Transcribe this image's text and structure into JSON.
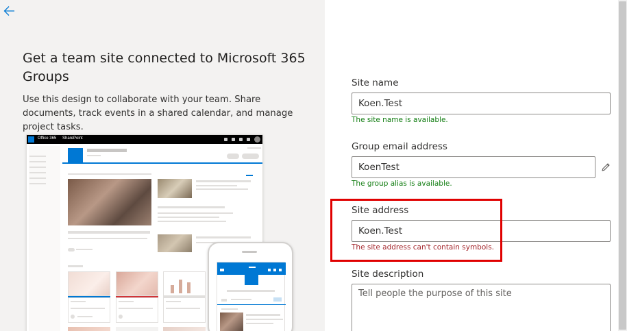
{
  "intro": {
    "title": "Get a team site connected to Microsoft 365 Groups",
    "description": "Use this design to collaborate with your team. Share documents, track events in a shared calendar, and manage project tasks."
  },
  "preview": {
    "app_name": "Office 365",
    "product_name": "SharePoint"
  },
  "form": {
    "site_name": {
      "label": "Site name",
      "value": "Koen.Test",
      "message": "The site name is available."
    },
    "group_email": {
      "label": "Group email address",
      "value": "KoenTest",
      "message": "The group alias is available."
    },
    "site_address": {
      "label": "Site address",
      "value": "Koen.Test",
      "message": "The site address can't contain symbols."
    },
    "site_description": {
      "label": "Site description",
      "placeholder": "Tell people the purpose of this site"
    }
  },
  "colors": {
    "accent": "#0078d4",
    "success": "#107c10",
    "error": "#a4262c",
    "highlight": "#e00000"
  },
  "icons": {
    "back": "back-arrow-icon",
    "edit": "pencil-icon"
  }
}
